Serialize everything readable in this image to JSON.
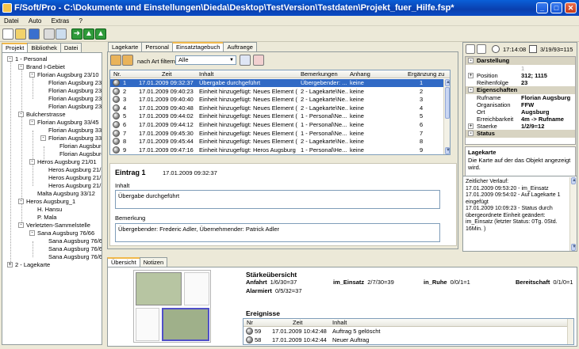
{
  "window": {
    "title": "F/Soft/Pro - C:\\Dokumente und Einstellungen\\Dieda\\Desktop\\TestVersion\\Testdaten\\Projekt_fuer_Hilfe.fsp*"
  },
  "menu": [
    "Datei",
    "Auto",
    "Extras",
    "?"
  ],
  "toolbar": {
    "time_label": "17:14:08",
    "date_label": "3/19/93=115"
  },
  "left_tabs": [
    "Projekt",
    "Bibliothek",
    "Datei"
  ],
  "tree": [
    {
      "label": "1 - Personal",
      "level": 0,
      "box": "-"
    },
    {
      "label": "Brand I-Gebiet",
      "level": 1,
      "box": "-"
    },
    {
      "label": "Florian Augsburg 23/10",
      "level": 2,
      "box": "-"
    },
    {
      "label": "Florian Augsburg 23/1",
      "level": 3,
      "box": ""
    },
    {
      "label": "Florian Augsburg 23/1",
      "level": 3,
      "box": ""
    },
    {
      "label": "Florian Augsburg 23/1",
      "level": 3,
      "box": ""
    },
    {
      "label": "Florian Augsburg 23/1",
      "level": 3,
      "box": ""
    },
    {
      "label": "Bulcherstrasse",
      "level": 1,
      "box": "-"
    },
    {
      "label": "Florian Augsburg 33/45",
      "level": 2,
      "box": "-"
    },
    {
      "label": "Florian Augsburg 33/4",
      "level": 3,
      "box": ""
    },
    {
      "label": "Florian Augsburg 33/4",
      "level": 3,
      "box": "-"
    },
    {
      "label": "Florian Augsburg 3",
      "level": 4,
      "box": ""
    },
    {
      "label": "Florian Augsburg 3",
      "level": 4,
      "box": ""
    },
    {
      "label": "Heros Augsburg 21/01",
      "level": 2,
      "box": "-"
    },
    {
      "label": "Heros Augsburg 21/1!",
      "level": 3,
      "box": ""
    },
    {
      "label": "Heros Augsburg 21/1!",
      "level": 3,
      "box": ""
    },
    {
      "label": "Heros Augsburg 21/1!",
      "level": 3,
      "box": ""
    },
    {
      "label": "Malta Augsburg 33/12",
      "level": 2,
      "box": ""
    },
    {
      "label": "Heros Augsburg_1",
      "level": 1,
      "box": "-"
    },
    {
      "label": "H. Hansu",
      "level": 2,
      "box": ""
    },
    {
      "label": "P. Mala",
      "level": 2,
      "box": ""
    },
    {
      "label": "Verletzten-Sammelstelle",
      "level": 1,
      "box": "-"
    },
    {
      "label": "Sana Augsburg 76/66",
      "level": 2,
      "box": "-"
    },
    {
      "label": "Sana Augsburg 76/67",
      "level": 3,
      "box": ""
    },
    {
      "label": "Sana Augsburg 76/68",
      "level": 3,
      "box": ""
    },
    {
      "label": "Sana Augsburg 76/69",
      "level": 3,
      "box": ""
    },
    {
      "label": "2 - Lagekarte",
      "level": 0,
      "box": "+"
    }
  ],
  "center_tabs": [
    "Lagekarte",
    "Personal",
    "Einsatztagebuch",
    "Auftraege"
  ],
  "filter": {
    "label": "nach Art filtern",
    "value": "Alle"
  },
  "journal": {
    "columns": [
      "Nr.",
      "Zeit",
      "Inhalt",
      "Bemerkungen",
      "Anhang",
      "Ergänzung zu"
    ],
    "rows": [
      {
        "nr": "1",
        "zeit": "17.01.2009 09:32:37",
        "inhalt": "Übergabe durchgeführt",
        "bem": "Übergebender: ...",
        "anhang": "keine",
        "erg": "1"
      },
      {
        "nr": "2",
        "zeit": "17.01.2009 09:40:23",
        "inhalt": "Einheit hinzugefügt: Neues Element (...",
        "bem": "2 - Lagekarte\\Ne...",
        "anhang": "keine",
        "erg": "2"
      },
      {
        "nr": "3",
        "zeit": "17.01.2009 09:40:40",
        "inhalt": "Einheit hinzugefügt: Neues Element (...",
        "bem": "2 - Lagekarte\\Ne...",
        "anhang": "keine",
        "erg": "3"
      },
      {
        "nr": "4",
        "zeit": "17.01.2009 09:40:48",
        "inhalt": "Einheit hinzugefügt: Neues Element (...",
        "bem": "2 - Lagekarte\\Ne...",
        "anhang": "keine",
        "erg": "4"
      },
      {
        "nr": "5",
        "zeit": "17.01.2009 09:44:02",
        "inhalt": "Einheit hinzugefügt: Neues Element (...",
        "bem": "1 - Personal\\Ne...",
        "anhang": "keine",
        "erg": "5"
      },
      {
        "nr": "6",
        "zeit": "17.01.2009 09:44:12",
        "inhalt": "Einheit hinzugefügt: Neues Element (...",
        "bem": "1 - Personal\\Ne...",
        "anhang": "keine",
        "erg": "6"
      },
      {
        "nr": "7",
        "zeit": "17.01.2009 09:45:30",
        "inhalt": "Einheit hinzugefügt: Neues Element (...",
        "bem": "1 - Personal\\Ne...",
        "anhang": "keine",
        "erg": "7"
      },
      {
        "nr": "8",
        "zeit": "17.01.2009 09:45:44",
        "inhalt": "Einheit hinzugefügt: Neues Element (...",
        "bem": "2 - Lagekarte\\Ne...",
        "anhang": "keine",
        "erg": "8"
      },
      {
        "nr": "9",
        "zeit": "17.01.2009 09:47:16",
        "inhalt": "Einheit hinzugefügt: Heros Augsburg ...",
        "bem": "1 - Personal\\He...",
        "anhang": "keine",
        "erg": "9"
      }
    ]
  },
  "entry": {
    "title": "Eintrag 1",
    "time": "17.01.2009 09:32:37",
    "inhalt_label": "Inhalt",
    "inhalt_value": "Übergabe durchgeführt",
    "bem_label": "Bemerkung",
    "bem_value": "Übergebender: Frederic Adler, Übernehmender: Patrick Adler"
  },
  "bottom_tabs": [
    "Übersicht",
    "Notizen"
  ],
  "overview": {
    "heading": "Stärkeübersicht",
    "stats": [
      {
        "k": "Anfahrt",
        "v": "1/6/30=37"
      },
      {
        "k": "im_Einsatz",
        "v": "2/7/30=39"
      },
      {
        "k": "in_Ruhe",
        "v": "0/0/1=1"
      },
      {
        "k": "Bereitschaft",
        "v": "0/1/0=1"
      },
      {
        "k": "Alarmiert",
        "v": "0/5/32=37"
      }
    ],
    "events_heading": "Ereignisse",
    "events_columns": [
      "Nr",
      "Zeit",
      "Inhalt"
    ],
    "events": [
      {
        "nr": "59",
        "zeit": "17.01.2009 10:42:48",
        "inhalt": "Auftrag 5 gelöscht"
      },
      {
        "nr": "58",
        "zeit": "17.01.2009 10:42:44",
        "inhalt": "Neuer Auftrag"
      }
    ]
  },
  "properties": {
    "sections": [
      {
        "title": "Darstellung",
        "rows": [
          {
            "k": "",
            "v": "1",
            "gray": true
          },
          {
            "k": "Position",
            "v": "312; 1115",
            "expand": true
          },
          {
            "k": "Reihenfolge",
            "v": "23"
          }
        ]
      },
      {
        "title": "Eigenschaften",
        "rows": [
          {
            "k": "Rufname",
            "v": "Florian Augsburg"
          },
          {
            "k": "Organisation",
            "v": "FFW"
          },
          {
            "k": "Ort",
            "v": "Augsburg"
          },
          {
            "k": "Erreichbarkeit",
            "v": "4m -> Rufname"
          },
          {
            "k": "Staerke",
            "v": "1/2/9=12",
            "expand": true
          }
        ]
      },
      {
        "title": "Status",
        "rows": []
      }
    ],
    "desc_title": "Lagekarte",
    "desc_text": "Die Karte auf der das Objekt angezeigt wird."
  },
  "history": {
    "text": "Zeitlicher Verlauf:\n17.01.2009 09:53:20 - im_Einsatz\n17.01.2009 09:54:02 - Auf Lagekarte 1 eingefügt\n17.01.2009 10:09:23 - Status durch übergeordnete Einheit geändert: im_Einsatz (letzter Status: 0Tg. 0Std. 16Min. )"
  }
}
